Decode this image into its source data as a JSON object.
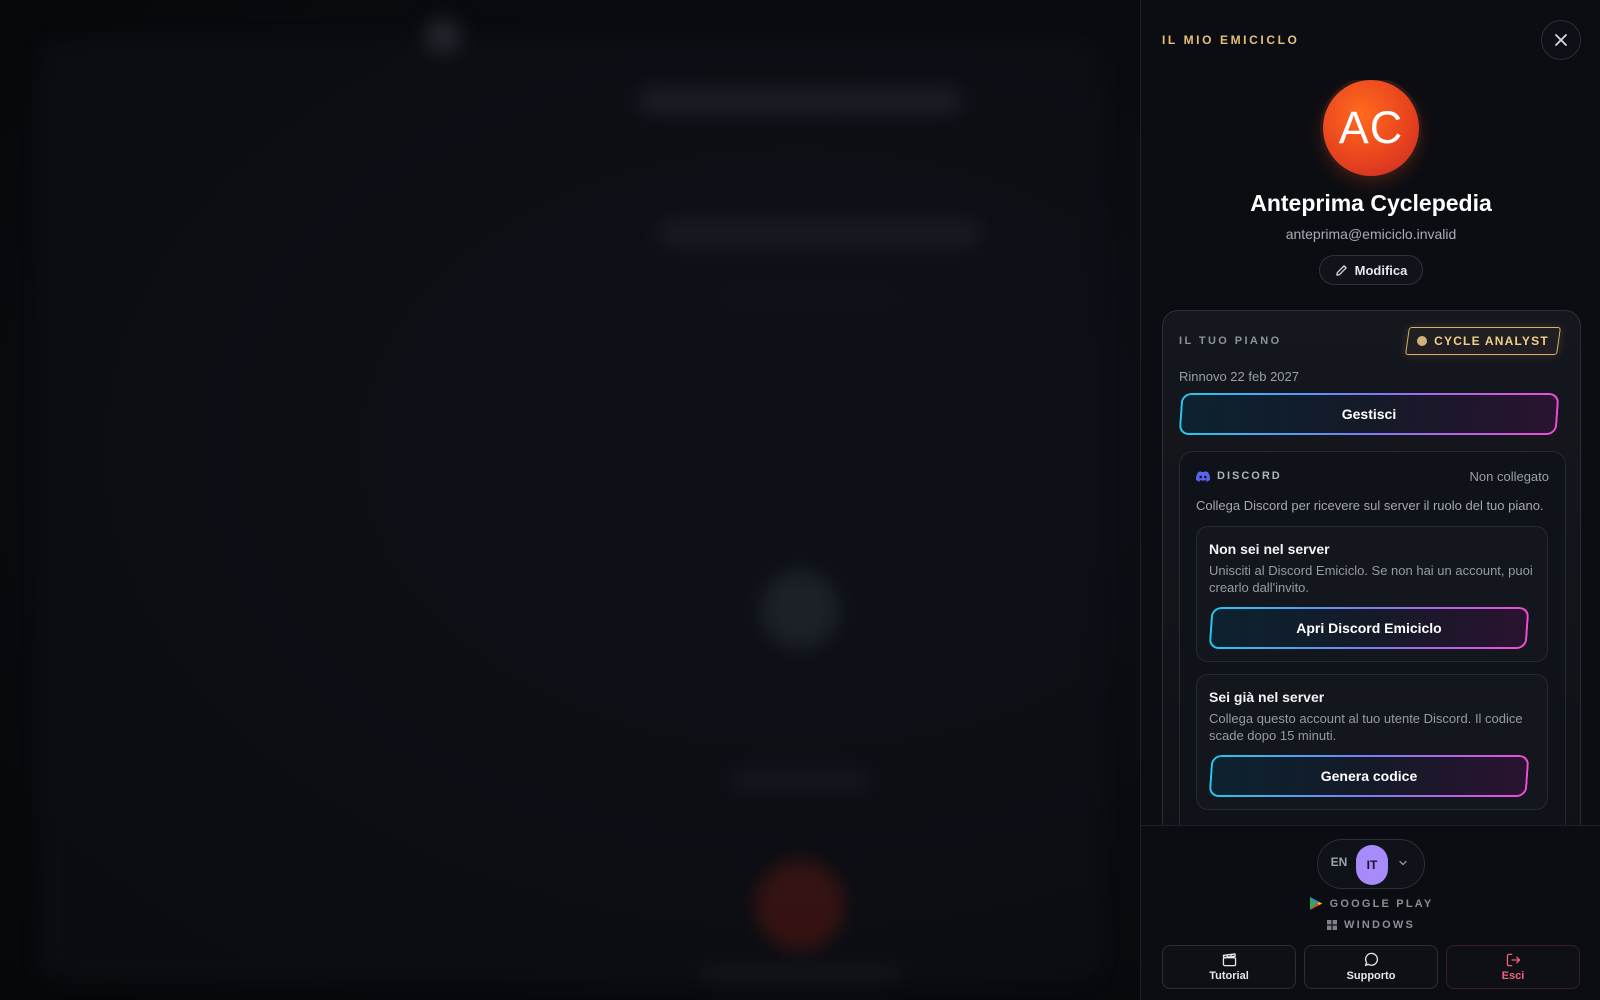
{
  "drawer": {
    "title": "IL MIO EMICICLO",
    "close_icon": "close-icon"
  },
  "profile": {
    "initials": "AC",
    "name": "Anteprima Cyclepedia",
    "email": "anteprima@emiciclo.invalid",
    "edit_label": "Modifica"
  },
  "plan": {
    "label": "IL TUO PIANO",
    "badge": "CYCLE ANALYST",
    "renewal": "Rinnovo 22 feb 2027",
    "manage_label": "Gestisci"
  },
  "discord": {
    "label": "DISCORD",
    "status": "Non collegato",
    "description": "Collega Discord per ricevere sul server il ruolo del tuo piano.",
    "not_in_server": {
      "title": "Non sei nel server",
      "description": "Unisciti al Discord Emiciclo. Se non hai un account, puoi crearlo dall'invito.",
      "button": "Apri Discord Emiciclo"
    },
    "in_server": {
      "title": "Sei già nel server",
      "description": "Collega questo account al tuo utente Discord. Il codice scade dopo 15 minuti.",
      "button": "Genera codice"
    }
  },
  "language": {
    "options": [
      "EN",
      "IT"
    ],
    "selected": "IT"
  },
  "stores": {
    "google_play": "GOOGLE PLAY",
    "windows": "WINDOWS"
  },
  "footer": {
    "tutorial": "Tutorial",
    "support": "Supporto",
    "logout": "Esci"
  },
  "colors": {
    "accent_gold": "#e6c07a",
    "avatar": "#e9441d",
    "neon_cyan": "#25c8f0",
    "neon_pink": "#f04dd6",
    "language_active": "#a78bfa",
    "logout": "#f0627a",
    "discord": "#5865f2"
  }
}
